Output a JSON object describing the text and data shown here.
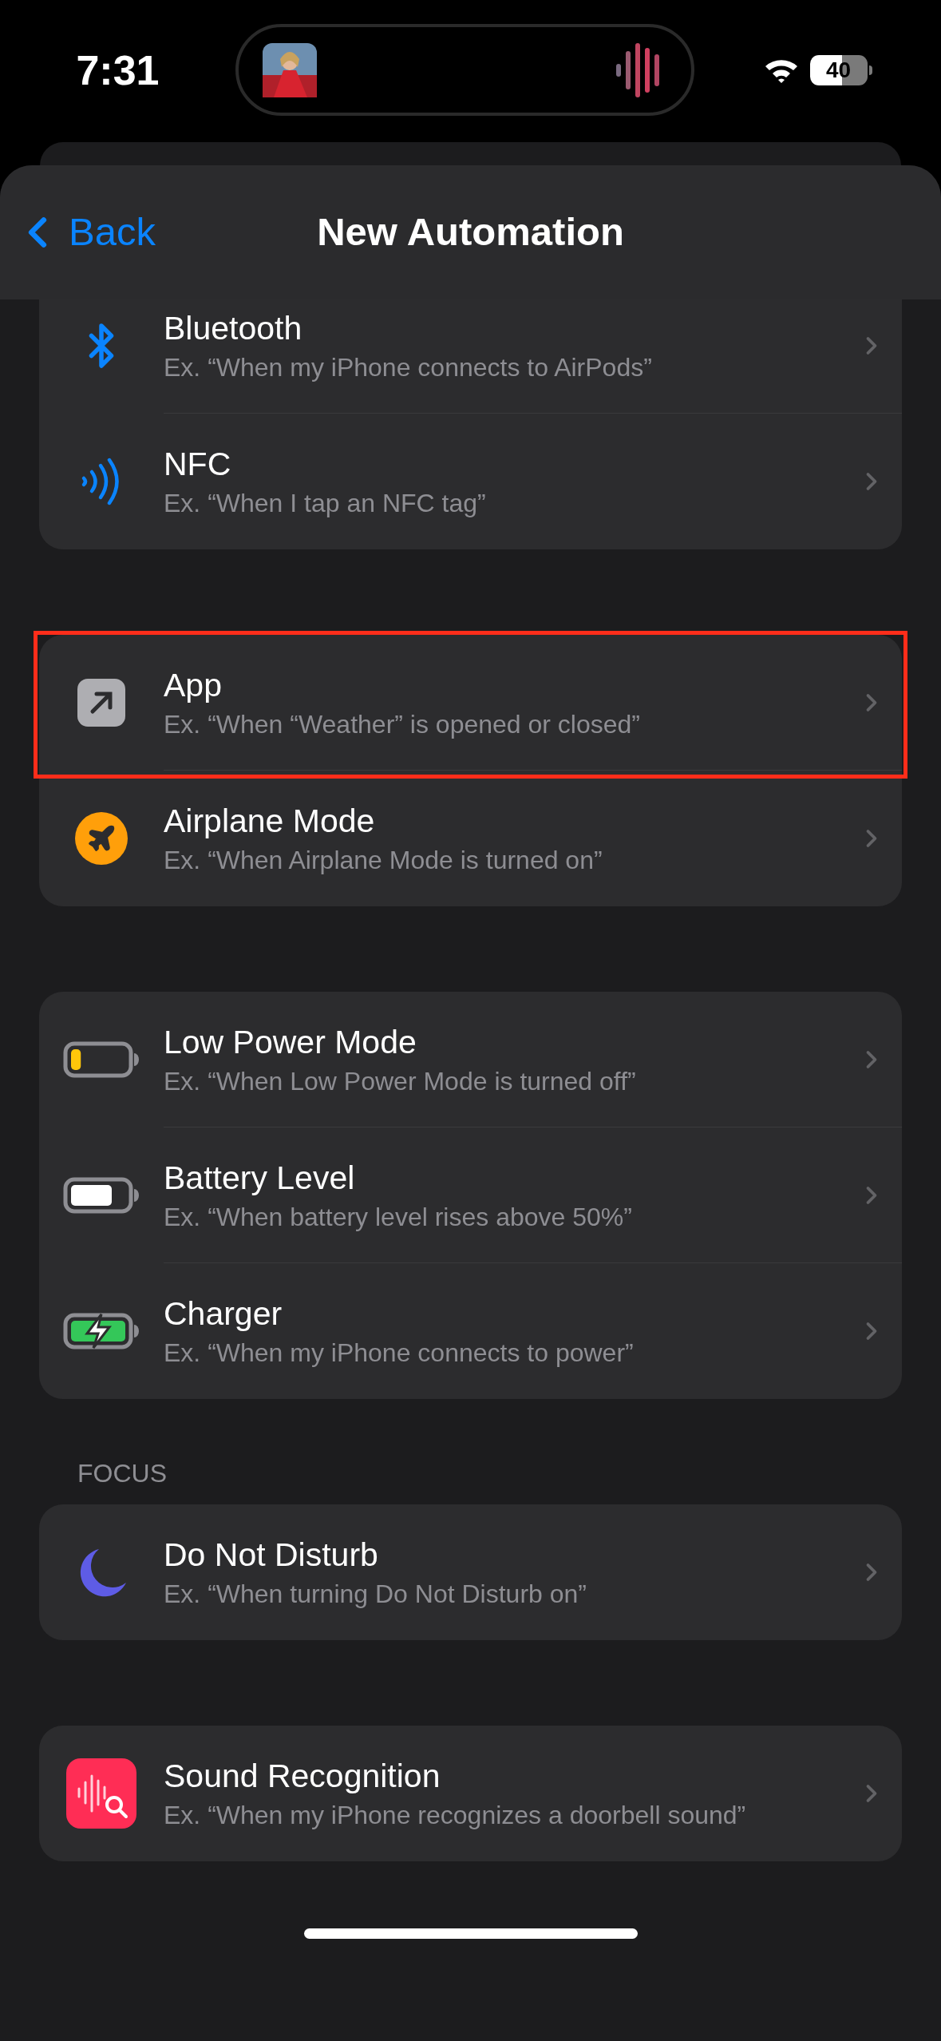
{
  "status_bar": {
    "time": "7:31",
    "battery": "40"
  },
  "nav": {
    "back": "Back",
    "title": "New Automation"
  },
  "sections": [
    {
      "rows": [
        {
          "kind": "bluetooth",
          "title": "Bluetooth",
          "subtitle": "Ex. “When my iPhone connects to AirPods”",
          "highlighted": false
        },
        {
          "kind": "nfc",
          "title": "NFC",
          "subtitle": "Ex. “When I tap an NFC tag”",
          "highlighted": false
        }
      ]
    },
    {
      "rows": [
        {
          "kind": "app",
          "title": "App",
          "subtitle": "Ex. “When “Weather” is opened or closed”",
          "highlighted": true
        },
        {
          "kind": "airplane",
          "title": "Airplane Mode",
          "subtitle": "Ex. “When Airplane Mode is turned on”",
          "highlighted": false
        }
      ]
    },
    {
      "rows": [
        {
          "kind": "low-power",
          "title": "Low Power Mode",
          "subtitle": "Ex. “When Low Power Mode is turned off”",
          "highlighted": false
        },
        {
          "kind": "battery",
          "title": "Battery Level",
          "subtitle": "Ex. “When battery level rises above 50%”",
          "highlighted": false
        },
        {
          "kind": "charger",
          "title": "Charger",
          "subtitle": "Ex. “When my iPhone connects to power”",
          "highlighted": false
        }
      ]
    },
    {
      "header": "FOCUS",
      "rows": [
        {
          "kind": "focus",
          "title": "Do Not Disturb",
          "subtitle": "Ex. “When turning Do Not Disturb on”",
          "highlighted": false
        }
      ]
    },
    {
      "rows": [
        {
          "kind": "sound",
          "title": "Sound Recognition",
          "subtitle": "Ex. “When my iPhone recognizes a doorbell sound”",
          "highlighted": false
        }
      ]
    }
  ]
}
